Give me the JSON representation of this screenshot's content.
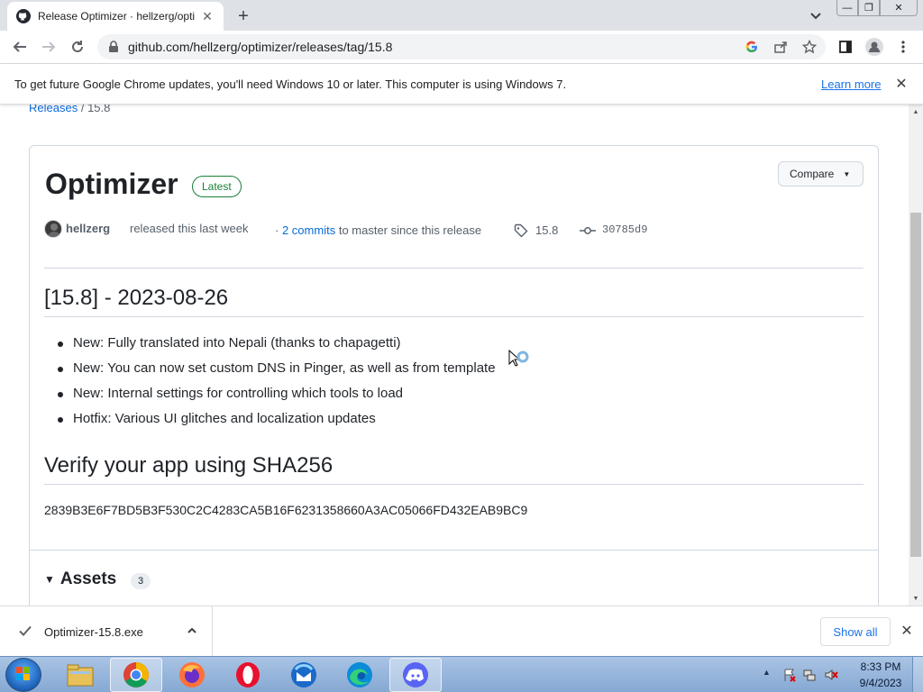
{
  "browser": {
    "tab_title": "Release Optimizer · hellzerg/optimizer",
    "url": "github.com/hellzerg/optimizer/releases/tag/15.8",
    "infobar_message": "To get future Google Chrome updates, you'll need Windows 10 or later. This computer is using Windows 7.",
    "infobar_link": "Learn more"
  },
  "page": {
    "breadcrumb_link": "Releases",
    "breadcrumb_sep": "/",
    "breadcrumb_current": "15.8",
    "release_title": "Optimizer",
    "latest_badge": "Latest",
    "compare_label": "Compare",
    "author": "hellzerg",
    "released_text": "released this last week",
    "commits_prefix": "·",
    "commits_link": "2 commits",
    "commits_suffix": "to master since this release",
    "tag": "15.8",
    "commit_sha": "30785d9",
    "changelog_heading": "[15.8] - 2023-08-26",
    "changelog": [
      "New: Fully translated into Nepali (thanks to chapagetti)",
      "New: You can now set custom DNS in Pinger, as well as from template",
      "New: Internal settings for controlling which tools to load",
      "Hotfix: Various UI glitches and localization updates"
    ],
    "verify_heading": "Verify your app using SHA256",
    "sha256": "2839B3E6F7BD5B3F530C2C4283CA5B16F6231358660A3AC05066FD432EAB9BC9",
    "assets_label": "Assets",
    "assets_count": "3"
  },
  "downloads": {
    "file_name": "Optimizer-15.8.exe",
    "show_all": "Show all"
  },
  "taskbar": {
    "apps": [
      "windows-explorer",
      "google-chrome",
      "firefox",
      "opera",
      "thunderbird",
      "microsoft-edge",
      "discord"
    ],
    "time": "8:33 PM",
    "date": "9/4/2023"
  },
  "colors": {
    "link": "#0969da",
    "latest_green": "#1a7f37",
    "chrome_tabstrip": "#dee1e6"
  }
}
